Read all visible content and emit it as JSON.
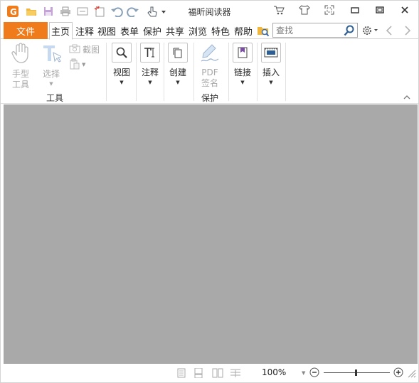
{
  "window": {
    "title": "福昕阅读器"
  },
  "quick_access": [
    "app-logo-icon",
    "open-folder-icon",
    "save-icon",
    "print-icon",
    "scan-icon",
    "new-document-icon",
    "undo-icon",
    "redo-icon",
    "hand-pointer-icon",
    "customize-dropdown-icon"
  ],
  "menu": {
    "file_label": "文件",
    "tabs": [
      "主页",
      "注释",
      "视图",
      "表单",
      "保护",
      "共享",
      "浏览",
      "特色",
      "帮助"
    ],
    "active_tab": "主页"
  },
  "search": {
    "value": "",
    "placeholder": "查找"
  },
  "ribbon": {
    "tools_group": {
      "hand_label": "手型\n工具",
      "select_label": "选择",
      "screenshot_label": "截图",
      "group_label": "工具"
    },
    "view_label": "视图",
    "annotate_label": "注释",
    "create_label": "创建",
    "pdf_sign_label": "PDF\n签名",
    "protect_group_label": "保护",
    "link_label": "链接",
    "insert_label": "插入"
  },
  "status": {
    "zoom": "100%"
  },
  "colors": {
    "accent": "#ef7b1a",
    "doc_background": "#a9a9a9"
  }
}
